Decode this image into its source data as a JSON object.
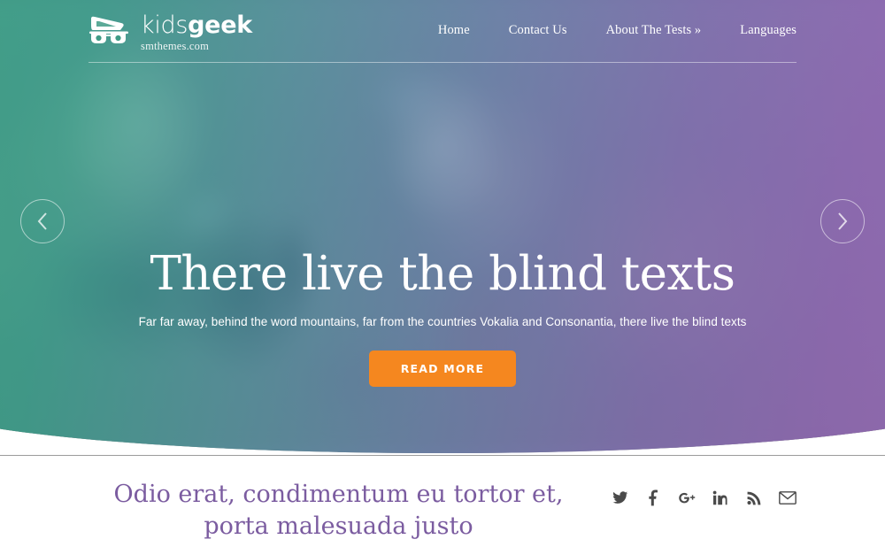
{
  "brand": {
    "name_light": "kids",
    "name_bold": "geek",
    "tagline": "smthemes.com",
    "logo_icon": "geek-glasses-logo-icon"
  },
  "nav": {
    "items": [
      {
        "label": "Home",
        "name": "nav-item-home"
      },
      {
        "label": "Contact Us",
        "name": "nav-item-contact-us"
      },
      {
        "label": "About The Tests »",
        "name": "nav-item-about-the-tests"
      },
      {
        "label": "Languages",
        "name": "nav-item-languages"
      }
    ]
  },
  "slider": {
    "prev_icon": "chevron-left-icon",
    "next_icon": "chevron-right-icon",
    "title": "There live the blind texts",
    "subtitle": "Far far away, behind the word mountains, far from the countries Vokalia and Consonantia, there live the blind texts",
    "cta_label": "READ MORE",
    "cta_color": "#f5871f"
  },
  "lower": {
    "heading": "Odio erat, condimentum eu tortor et, porta malesuada justo",
    "heading_color": "#7b5ca0",
    "social": [
      {
        "name": "twitter-icon",
        "label": "Twitter"
      },
      {
        "name": "facebook-icon",
        "label": "Facebook"
      },
      {
        "name": "google-plus-icon",
        "label": "Google Plus"
      },
      {
        "name": "linkedin-icon",
        "label": "LinkedIn"
      },
      {
        "name": "rss-icon",
        "label": "RSS"
      },
      {
        "name": "email-icon",
        "label": "Email"
      }
    ]
  },
  "theme": {
    "gradient_start": "#2aa07d",
    "gradient_end": "#9664ba",
    "divider": "#9b9b9b"
  }
}
